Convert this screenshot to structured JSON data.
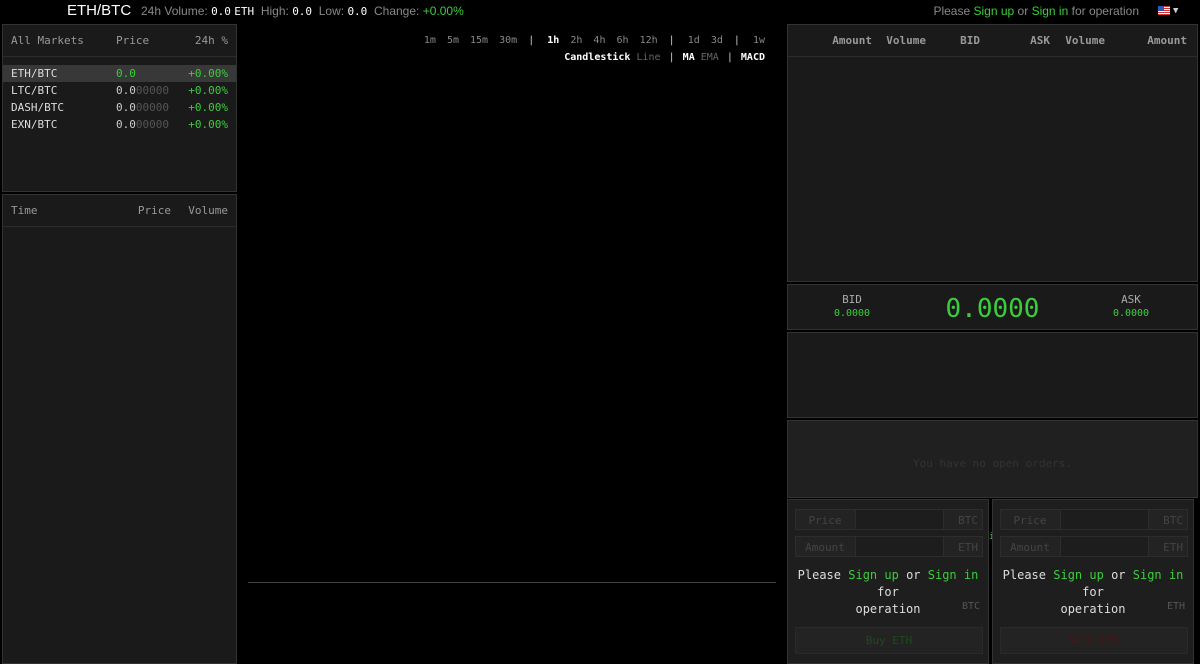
{
  "header": {
    "pair": "ETH/BTC",
    "volume_label": "24h Volume:",
    "volume_value": "0.0",
    "volume_unit": "ETH",
    "high_label": "High:",
    "high_value": "0.0",
    "low_label": "Low:",
    "low_value": "0.0",
    "change_label": "Change:",
    "change_value": "+0.00%",
    "auth_please": "Please",
    "auth_signup": "Sign up",
    "auth_or": "or",
    "auth_signin": "Sign in",
    "auth_tail": "for operation",
    "flag_icon": "us-flag-icon",
    "colors": {
      "accent": "#3dcc3d",
      "background": "#000000",
      "panel": "#1a1a1a"
    }
  },
  "markets": {
    "columns": [
      "All Markets",
      "Price",
      "24h %"
    ],
    "rows": [
      {
        "name": "ETH/BTC",
        "price": "0.0",
        "price_dim": "",
        "change": "+0.00%"
      },
      {
        "name": "LTC/BTC",
        "price": "0.0",
        "price_dim": "00000",
        "change": "+0.00%"
      },
      {
        "name": "DASH/BTC",
        "price": "0.0",
        "price_dim": "00000",
        "change": "+0.00%"
      },
      {
        "name": "EXN/BTC",
        "price": "0.0",
        "price_dim": "00000",
        "change": "+0.00%"
      }
    ]
  },
  "trades": {
    "columns": [
      "Time",
      "Price",
      "Volume"
    ]
  },
  "chart": {
    "periods_a": [
      "1m",
      "5m",
      "15m",
      "30m"
    ],
    "periods_b": [
      "1h",
      "2h",
      "4h",
      "6h",
      "12h"
    ],
    "periods_c": [
      "1d",
      "3d"
    ],
    "periods_d": [
      "1w"
    ],
    "active_period": "1h",
    "type_candlestick": "Candlestick",
    "type_line": "Line",
    "ind_ma": "MA",
    "ind_ema": "EMA",
    "ind_macd": "MACD",
    "separator": "|"
  },
  "orderbook": {
    "columns": [
      "Amount",
      "Volume",
      "BID",
      "ASK",
      "Volume",
      "Amount"
    ]
  },
  "ticker": {
    "bid_label": "BID",
    "bid_value": "0.0000",
    "last": "0.0000",
    "ask_label": "ASK",
    "ask_value": "0.0000"
  },
  "open_orders": {
    "empty": "You have no open orders."
  },
  "buy_form": {
    "price_label": "Price",
    "price_unit": "BTC",
    "amount_label": "Amount",
    "amount_unit": "ETH",
    "note_please": "Please",
    "note_signup": "Sign up",
    "note_or": "or",
    "note_signin": "Sign in",
    "note_for": "for",
    "note_operation": "operation",
    "balance_unit": "BTC",
    "button": "Buy ETH"
  },
  "sell_form": {
    "price_label": "Price",
    "price_unit": "BTC",
    "amount_label": "Amount",
    "amount_unit": "ETH",
    "note_please": "Please",
    "note_signup": "Sign up",
    "note_or": "or",
    "note_signin": "Sign in",
    "note_for": "for",
    "note_operation": "operation",
    "balance_unit": "ETH",
    "button": "Sell ETH"
  }
}
